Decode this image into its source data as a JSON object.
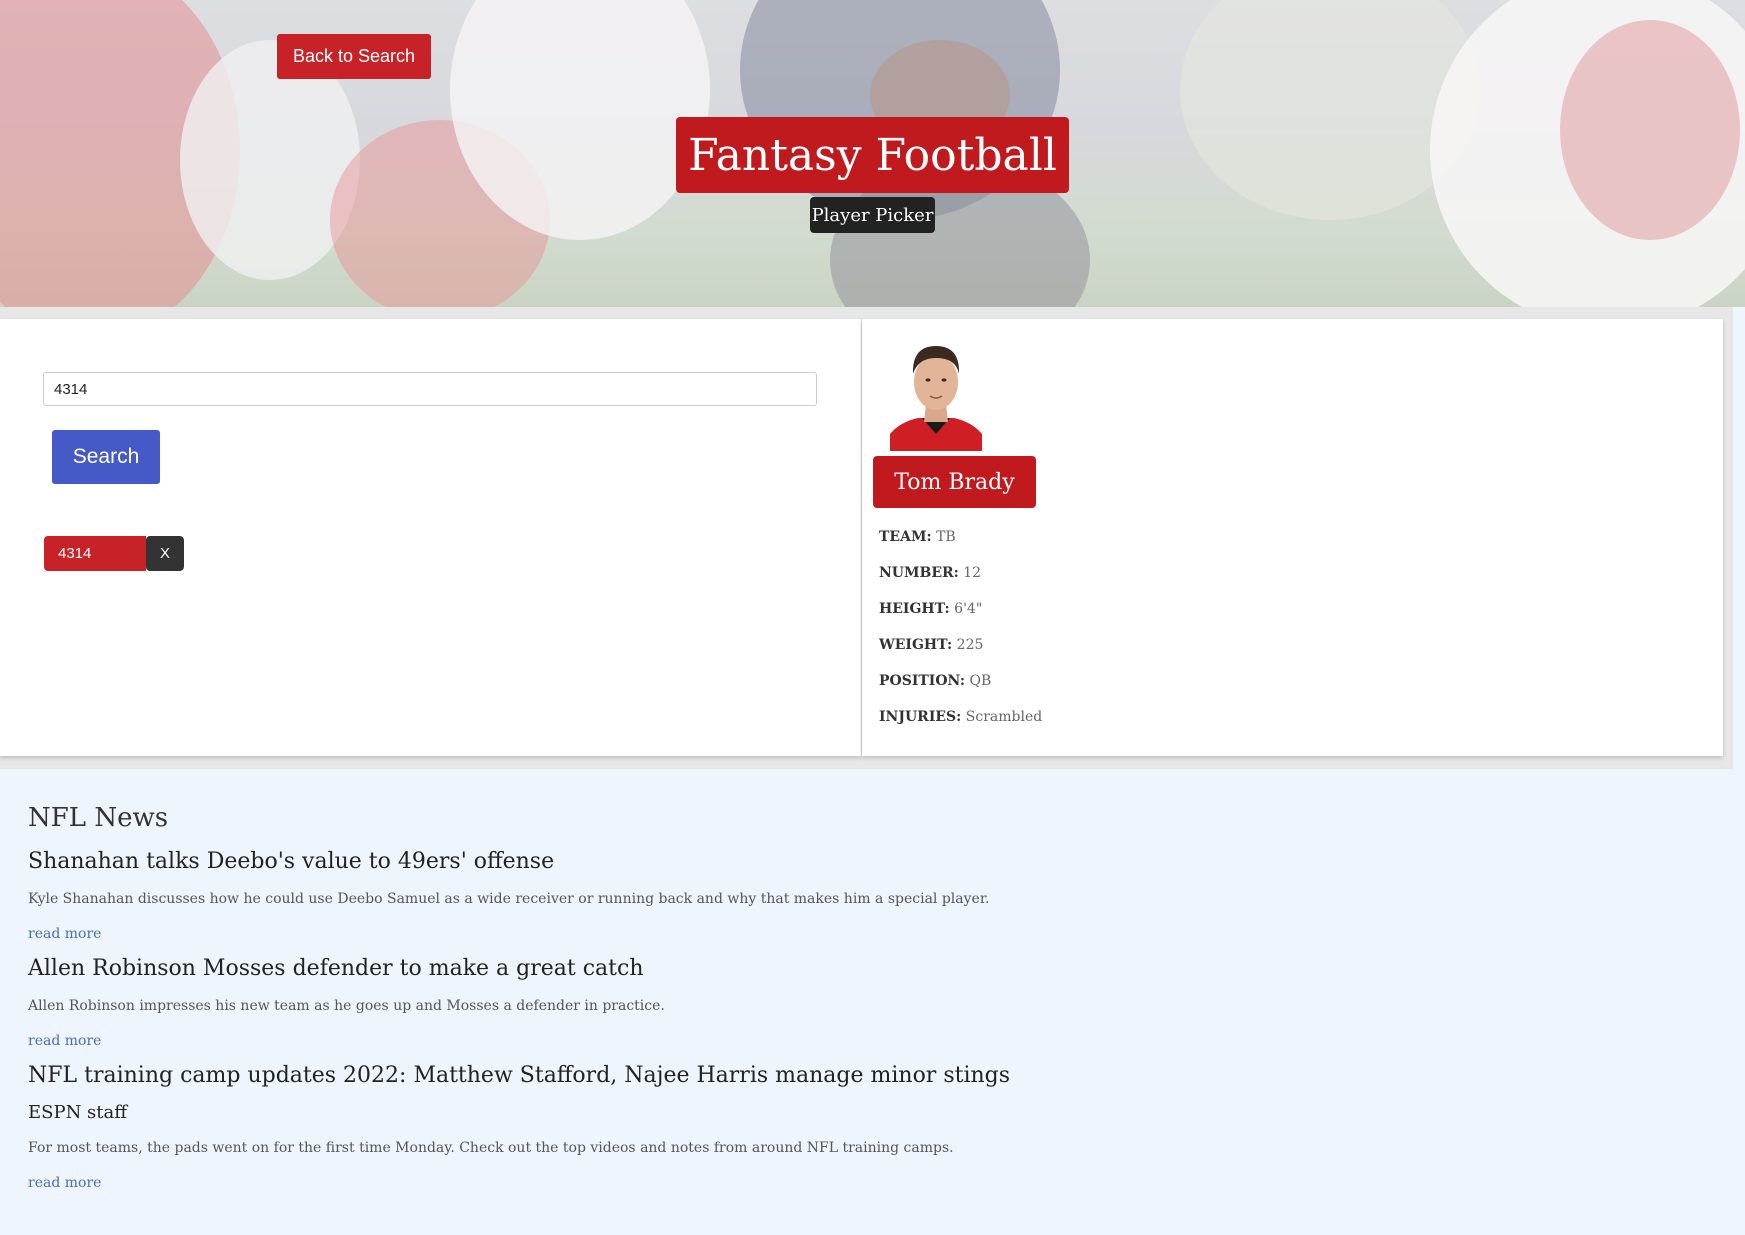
{
  "header": {
    "back_button": "Back to Search",
    "title": "Fantasy Football",
    "subtitle": "Player Picker"
  },
  "search": {
    "input_value": "4314",
    "button_label": "Search",
    "chips": [
      {
        "label": "4314",
        "remove_label": "X"
      }
    ]
  },
  "player": {
    "name": "Tom Brady",
    "photo_icon": "player-headshot",
    "stats": [
      {
        "label": "TEAM:",
        "value": "TB"
      },
      {
        "label": "NUMBER:",
        "value": "12"
      },
      {
        "label": "HEIGHT:",
        "value": "6'4\""
      },
      {
        "label": "WEIGHT:",
        "value": "225"
      },
      {
        "label": "POSITION:",
        "value": "QB"
      },
      {
        "label": "INJURIES:",
        "value": "Scrambled"
      }
    ]
  },
  "news": {
    "heading": "NFL News",
    "items": [
      {
        "title": "Shanahan talks Deebo's value to 49ers' offense",
        "description": "Kyle Shanahan discusses how he could use Deebo Samuel as a wide receiver or running back and why that makes him a special player.",
        "link": "read more"
      },
      {
        "title": "Allen Robinson Mosses defender to make a great catch",
        "description": "Allen Robinson impresses his new team as he goes up and Mosses a defender in practice.",
        "link": "read more"
      },
      {
        "title": "NFL training camp updates 2022: Matthew Stafford, Najee Harris manage minor stings",
        "byline": "ESPN staff",
        "description": "For most teams, the pads went on for the first time Monday. Check out the top videos and notes from around NFL training camps.",
        "link": "read more"
      }
    ]
  },
  "colors": {
    "accent_red": "#c01a1f",
    "search_blue": "#4559c7",
    "link_blue": "#4a6cc0",
    "news_bg": "#eef5fd"
  }
}
